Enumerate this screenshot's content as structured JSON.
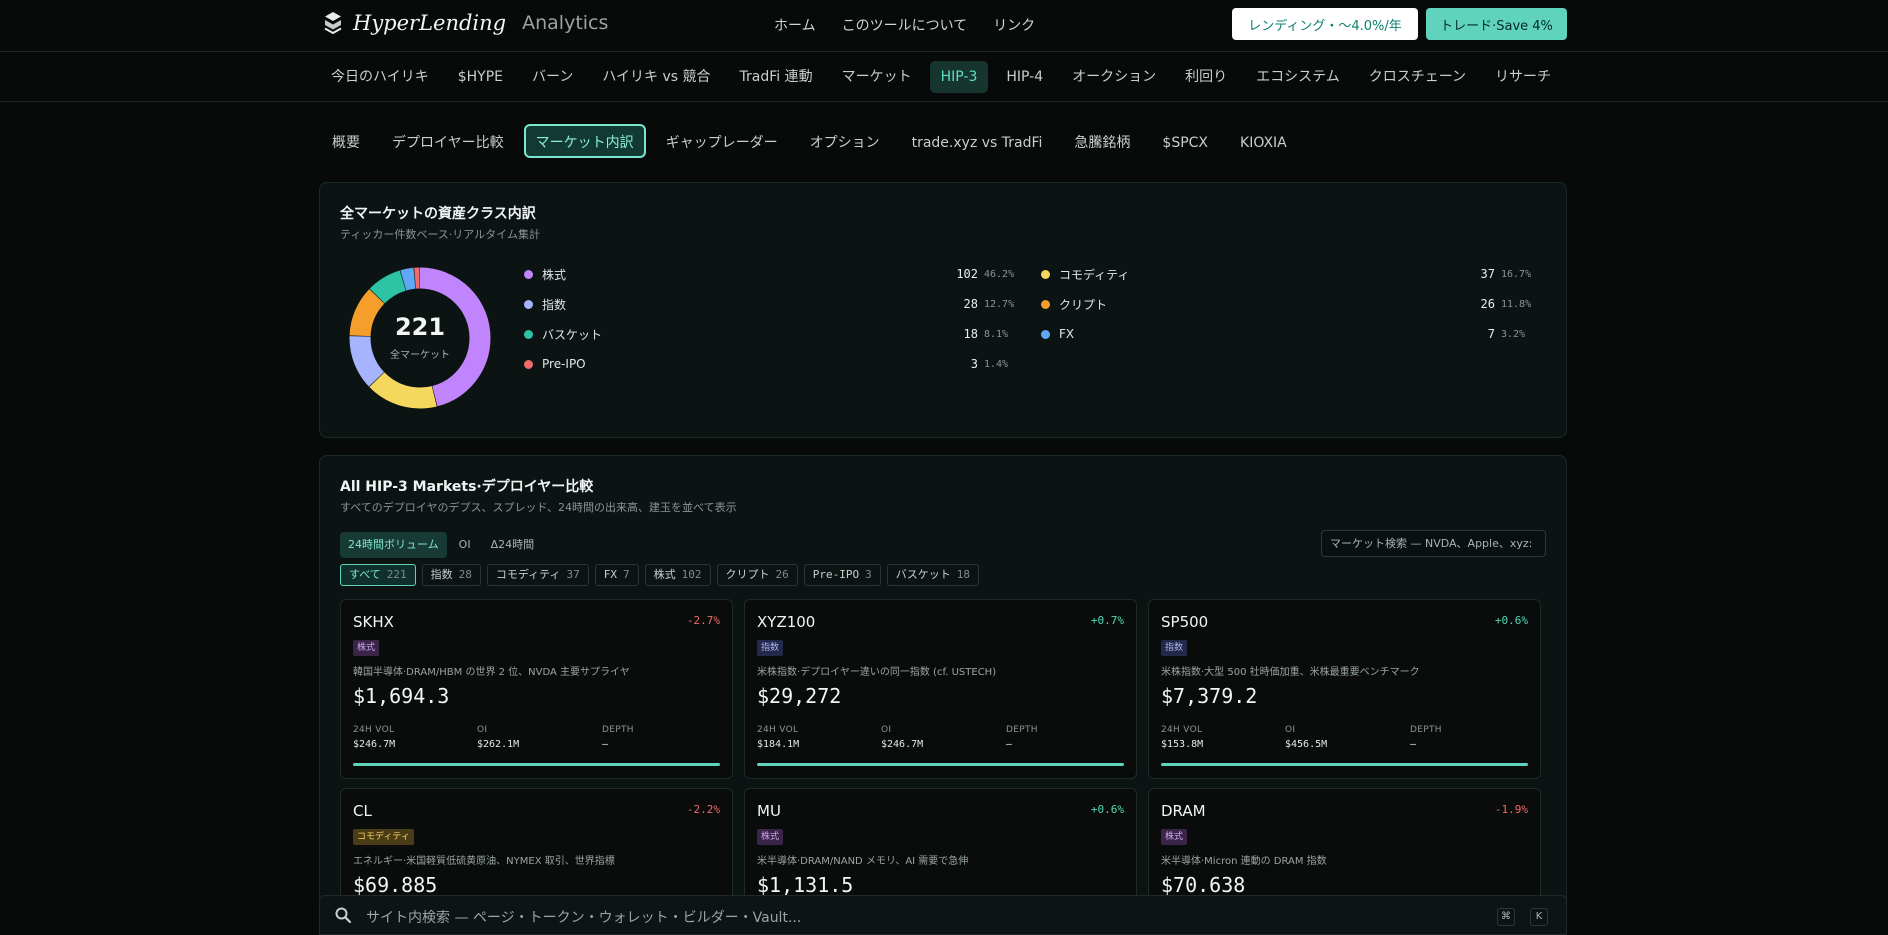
{
  "header": {
    "brand_name": "HyperLending",
    "brand_sub": "Analytics",
    "nav": [
      "ホーム",
      "このツールについて",
      "リンク"
    ],
    "lend_button": "レンディング・〜4.0%/年",
    "trade_button": "トレード·Save 4%"
  },
  "main_nav": [
    "今日のハイリキ",
    "$HYPE",
    "バーン",
    "ハイリキ vs 競合",
    "TradFi 連動",
    "マーケット",
    "HIP-3",
    "HIP-4",
    "オークション",
    "利回り",
    "エコシステム",
    "クロスチェーン",
    "リサーチ"
  ],
  "main_nav_active": 6,
  "sub_nav": [
    "概要",
    "デプロイヤー比較",
    "マーケット内訳",
    "ギャップレーダー",
    "オプション",
    "trade.xyz vs TradFi",
    "急騰銘柄",
    "$SPCX",
    "KIOXIA"
  ],
  "sub_nav_active": 2,
  "breakdown": {
    "title": "全マーケットの資産クラス内訳",
    "subtitle": "ティッカー件数ベース·リアルタイム集計",
    "total": "221",
    "total_label": "全マーケット",
    "classes": [
      {
        "name": "株式",
        "count": 102,
        "pct": "46.2%",
        "color": "#c084fc"
      },
      {
        "name": "コモディティ",
        "count": 37,
        "pct": "16.7%",
        "color": "#f5d75e"
      },
      {
        "name": "指数",
        "count": 28,
        "pct": "12.7%",
        "color": "#a5b4fc"
      },
      {
        "name": "クリプト",
        "count": 26,
        "pct": "11.8%",
        "color": "#f59e2b"
      },
      {
        "name": "バスケット",
        "count": 18,
        "pct": "8.1%",
        "color": "#2dc3a5"
      },
      {
        "name": "FX",
        "count": 7,
        "pct": "3.2%",
        "color": "#5ea8f5"
      },
      {
        "name": "Pre-IPO",
        "count": 3,
        "pct": "1.4%",
        "color": "#f06b6b"
      }
    ]
  },
  "markets": {
    "title": "All HIP-3 Markets·デプロイヤー比較",
    "subtitle": "すべてのデプロイヤのデプス、スプレッド、24時間の出来高、建玉を並べて表示",
    "metric_tabs": [
      "24時間ボリューム",
      "OI",
      "Δ24時間"
    ],
    "metric_active": 0,
    "search_placeholder": "マーケット検索 — NVDA、Apple、xyz:",
    "filters": [
      {
        "label": "すべて",
        "count": "221"
      },
      {
        "label": "指数",
        "count": "28"
      },
      {
        "label": "コモディティ",
        "count": "37"
      },
      {
        "label": "FX",
        "count": "7"
      },
      {
        "label": "株式",
        "count": "102"
      },
      {
        "label": "クリプト",
        "count": "26"
      },
      {
        "label": "Pre-IPO",
        "count": "3"
      },
      {
        "label": "バスケット",
        "count": "18"
      }
    ],
    "filter_active": 0,
    "stat_labels": {
      "vol": "24H VOL",
      "oi": "OI",
      "depth": "DEPTH"
    },
    "cards": [
      {
        "ticker": "SKHX",
        "change": "-2.7%",
        "dir": "down",
        "badge": "株式",
        "badge_type": "stock",
        "desc": "韓国半導体·DRAM/HBM の世界 2 位、NVDA 主要サプライヤ",
        "price": "$1,694.3",
        "vol": "$246.7M",
        "oi": "$262.1M",
        "depth": "—"
      },
      {
        "ticker": "XYZ100",
        "change": "+0.7%",
        "dir": "up",
        "badge": "指数",
        "badge_type": "index",
        "desc": "米株指数·デプロイヤー違いの同一指数 (cf. USTECH)",
        "price": "$29,272",
        "vol": "$184.1M",
        "oi": "$246.7M",
        "depth": "—"
      },
      {
        "ticker": "SP500",
        "change": "+0.6%",
        "dir": "up",
        "badge": "指数",
        "badge_type": "index",
        "desc": "米株指数·大型 500 社時価加重、米株最重要ベンチマーク",
        "price": "$7,379.2",
        "vol": "$153.8M",
        "oi": "$456.5M",
        "depth": "—"
      },
      {
        "ticker": "CL",
        "change": "-2.2%",
        "dir": "down",
        "badge": "コモディティ",
        "badge_type": "commodity",
        "desc": "エネルギー·米国軽質低硫黄原油、NYMEX 取引、世界指標",
        "price": "$69.885",
        "vol": "",
        "oi": "",
        "depth": ""
      },
      {
        "ticker": "MU",
        "change": "+0.6%",
        "dir": "up",
        "badge": "株式",
        "badge_type": "stock",
        "desc": "米半導体·DRAM/NAND メモリ、AI 需要で急伸",
        "price": "$1,131.5",
        "vol": "",
        "oi": "",
        "depth": ""
      },
      {
        "ticker": "DRAM",
        "change": "-1.9%",
        "dir": "down",
        "badge": "株式",
        "badge_type": "stock",
        "desc": "米半導体·Micron 連動の DRAM 指数",
        "price": "$70.638",
        "vol": "",
        "oi": "",
        "depth": ""
      }
    ]
  },
  "site_search": {
    "placeholder": "サイト内検索 — ページ・トークン・ウォレット・ビルダー・Vault...",
    "key1": "⌘",
    "key2": "K"
  },
  "icons": {
    "brand": "logo-icon",
    "search": "search-icon"
  }
}
